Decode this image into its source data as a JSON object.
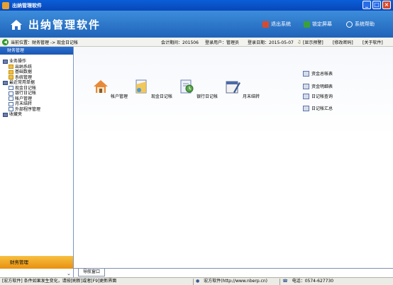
{
  "window": {
    "title": "出纳管理软件"
  },
  "banner": {
    "app_name": "出纳管理软件",
    "actions": [
      {
        "label": "退出系统",
        "icon": "exit-icon",
        "color": "#d94a2c"
      },
      {
        "label": "锁定屏幕",
        "icon": "lock-icon",
        "color": "#3aa03a"
      },
      {
        "label": "系统帮助",
        "icon": "help-icon",
        "color": "#ffffff"
      }
    ]
  },
  "infobar": {
    "location": "当前位置：财务管理 -> 现金日记帐",
    "period": "会计期间：201506",
    "user": "登录用户：管理员",
    "date": "登录日期：2015-05-07",
    "alert": "[显示预警]",
    "change_password": "[修改密码]",
    "about": "[关于软件]"
  },
  "sidebar": {
    "header": "财务管理",
    "footer": "财务管理",
    "tree": [
      {
        "label": "业务操作",
        "level": 0,
        "icon": "book-icon"
      },
      {
        "label": "出纳系统",
        "level": 1,
        "icon": "folder-icon"
      },
      {
        "label": "基础数据",
        "level": 1,
        "icon": "folder-icon"
      },
      {
        "label": "系统管理",
        "level": 1,
        "icon": "folder-icon"
      },
      {
        "label": "最近常用单据",
        "level": 0,
        "icon": "book-icon"
      },
      {
        "label": "现金日记帐",
        "level": 1,
        "icon": "doc-icon"
      },
      {
        "label": "银行日记帐",
        "level": 1,
        "icon": "doc-icon"
      },
      {
        "label": "帐户管理",
        "level": 1,
        "icon": "doc-icon"
      },
      {
        "label": "月末结转",
        "level": 1,
        "icon": "doc-icon"
      },
      {
        "label": "外部程序管理",
        "level": 1,
        "icon": "doc-icon"
      },
      {
        "label": "收藏夹",
        "level": 0,
        "icon": "book-icon"
      }
    ]
  },
  "main": {
    "tools": [
      {
        "label": "帐户管理",
        "icon": "account-house-icon"
      },
      {
        "label": "现金日记帐",
        "icon": "cash-journal-icon"
      },
      {
        "label": "银行日记帐",
        "icon": "bank-journal-icon"
      },
      {
        "label": "月末结转",
        "icon": "month-end-icon"
      }
    ],
    "reports": [
      {
        "label": "资金总帐表"
      },
      {
        "label": "资金明细表"
      },
      {
        "label": "日记帐查询"
      },
      {
        "label": "日记帐汇总"
      }
    ],
    "nav_tab": "导航窗口"
  },
  "statusbar": {
    "company": "[宏方软件] 条件如果发生变化，请按[刷新]或者[F9]更新界面",
    "website": "宏方软件(http://www.nberp.cn)",
    "phone": "电话：0574-627730"
  }
}
